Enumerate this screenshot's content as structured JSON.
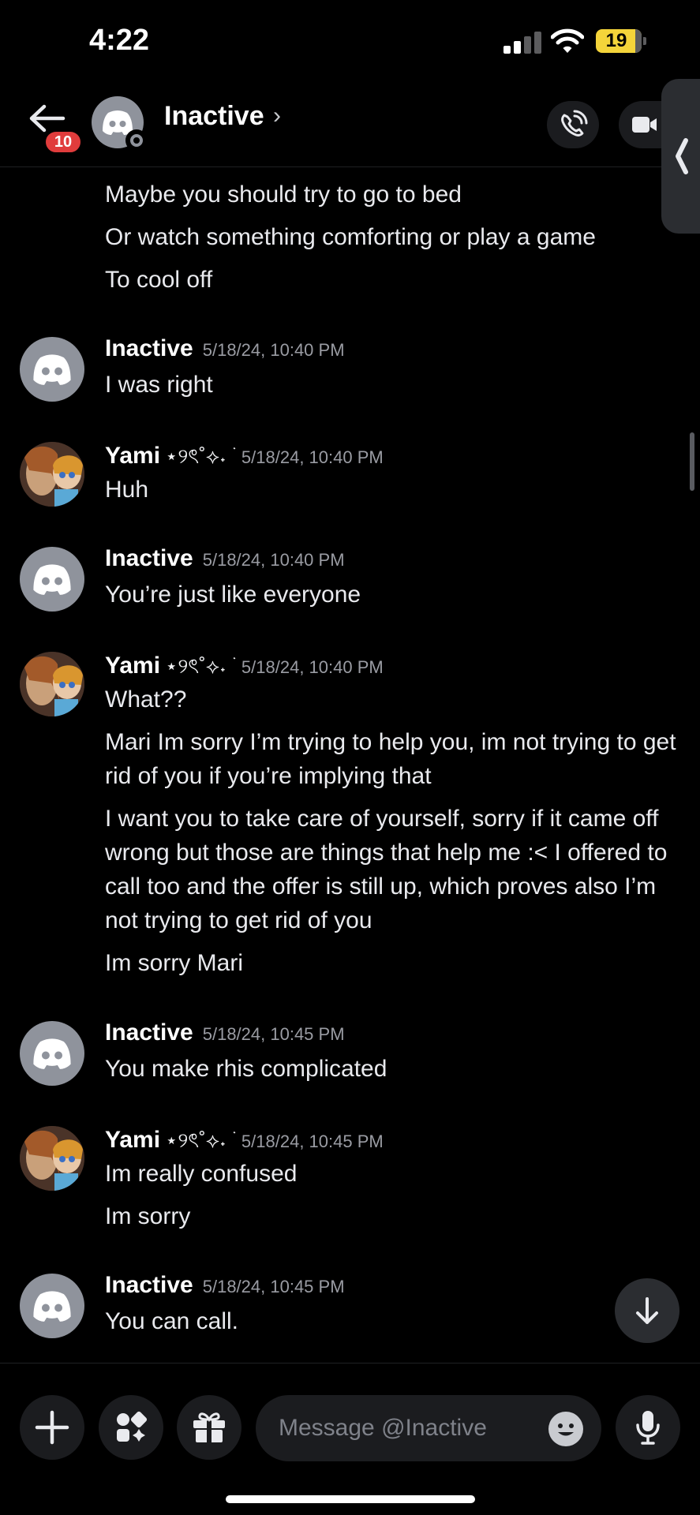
{
  "status_bar": {
    "time": "4:22",
    "battery": "19"
  },
  "header": {
    "badge": "10",
    "title": "Inactive",
    "chevron": "›"
  },
  "messages": [
    {
      "type": "continuation",
      "lines": [
        "Maybe you should try to go to bed",
        "Or watch something comforting or play a game",
        "To cool off"
      ]
    },
    {
      "author": "Inactive",
      "timestamp": "5/18/24, 10:40 PM",
      "lines": [
        "I was right"
      ]
    },
    {
      "author": "Yami",
      "deco": "⋆୨ৎ˚⟡˖ ࣪",
      "timestamp": "5/18/24, 10:40 PM",
      "lines": [
        "Huh"
      ]
    },
    {
      "author": "Inactive",
      "timestamp": "5/18/24, 10:40 PM",
      "lines": [
        "You’re just like everyone"
      ]
    },
    {
      "author": "Yami",
      "deco": "⋆୨ৎ˚⟡˖ ࣪",
      "timestamp": "5/18/24, 10:40 PM",
      "lines": [
        "What??",
        "Mari Im sorry I’m trying to help you, im not trying to get rid of you if you’re implying that",
        "I want you to take care of yourself, sorry if it came off wrong but those are things that help me :< I offered to call too and the offer is still up, which proves also I’m not trying to get rid of you",
        "Im sorry Mari"
      ]
    },
    {
      "author": "Inactive",
      "timestamp": "5/18/24, 10:45 PM",
      "lines": [
        "You make rhis complicated"
      ]
    },
    {
      "author": "Yami",
      "deco": "⋆୨ৎ˚⟡˖ ࣪",
      "timestamp": "5/18/24, 10:45 PM",
      "lines": [
        "Im really confused",
        "Im sorry"
      ]
    },
    {
      "author": "Inactive",
      "timestamp": "5/18/24, 10:45 PM",
      "lines": [
        "You can call."
      ]
    }
  ],
  "input": {
    "placeholder": "Message @Inactive"
  },
  "icons": {
    "back": "arrow-left-icon",
    "call": "phone-icon",
    "video": "video-camera-icon",
    "side_tab": "chevron-left-icon",
    "jump": "arrow-down-icon",
    "attach": "plus-icon",
    "apps": "apps-icon",
    "gift": "gift-icon",
    "emoji": "emoji-icon",
    "voice": "microphone-icon"
  },
  "colors": {
    "background": "#000000",
    "badge": "#e03c3c",
    "discord_avatar": "#8f939c",
    "battery": "#f4d43a",
    "control_bg": "#1b1c1f",
    "timestamp": "#9a9ca3"
  }
}
